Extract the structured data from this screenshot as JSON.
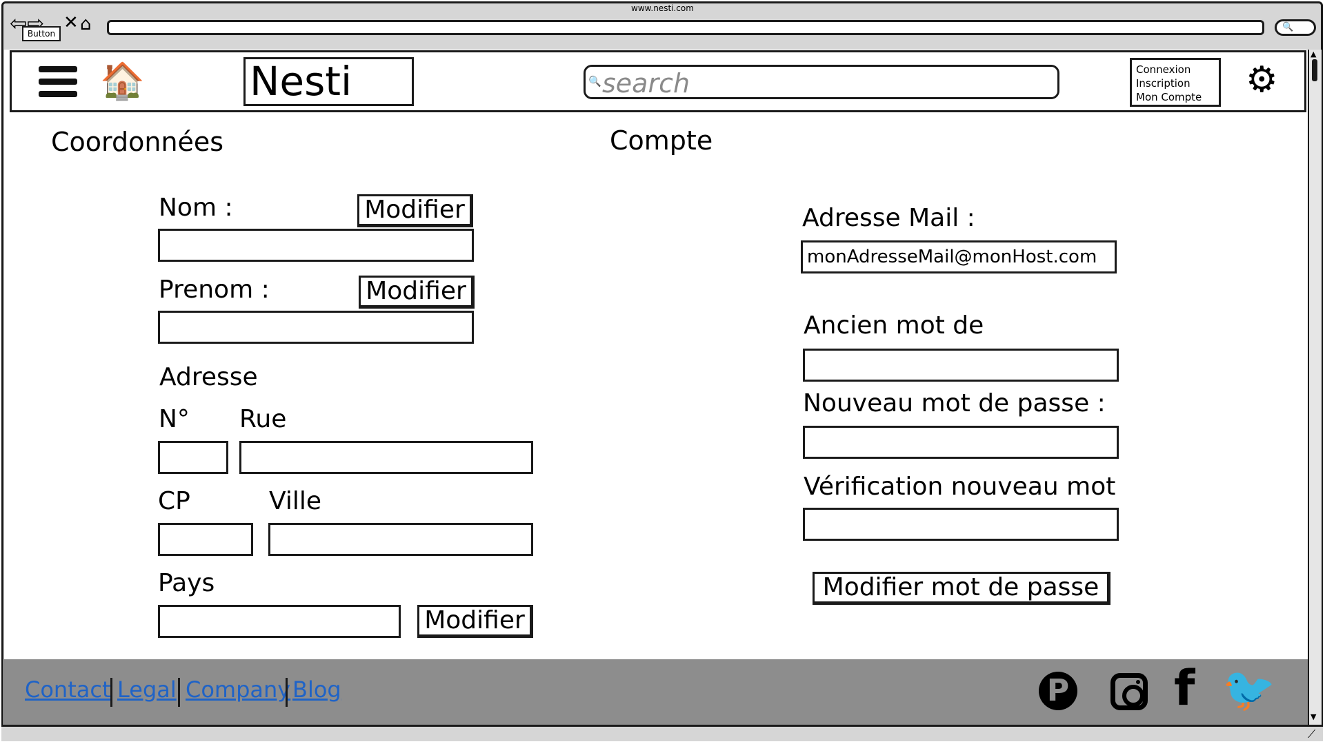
{
  "browser": {
    "url": "www.nesti.com",
    "button_label": "Button",
    "back_glyph": "⇦⇨",
    "close_glyph": "✕",
    "home_glyph": "⌂",
    "search_glyph": "🔍"
  },
  "header": {
    "menu_icon": "hamburger-icon",
    "home_icon": "home-icon",
    "home_glyph": "🏠",
    "logo": "Nesti",
    "search_placeholder": "search",
    "search_glyph": "🔍",
    "account_links": [
      "Connexion",
      "Inscription",
      "Mon Compte"
    ],
    "gear_glyph": "⚙"
  },
  "coordonnees": {
    "title": "Coordonnées",
    "nom_label": "Nom :",
    "prenom_label": "Prenom :",
    "modify_label": "Modifier",
    "adresse_title": "Adresse",
    "numero_label": "N°",
    "rue_label": "Rue",
    "cp_label": "CP",
    "ville_label": "Ville",
    "pays_label": "Pays"
  },
  "compte": {
    "title": "Compte",
    "email_label": "Adresse Mail :",
    "email_value": "monAdresseMail@monHost.com",
    "old_password_label": "Ancien mot de",
    "new_password_label": "Nouveau mot de passe :",
    "verify_password_label": "Vérification nouveau mot",
    "change_password_button": "Modifier mot de passe"
  },
  "footer": {
    "links": [
      "Contact",
      "Legal",
      "Company",
      "Blog"
    ],
    "social": {
      "pinterest": "P",
      "facebook": "f",
      "twitter": "🐦"
    },
    "colors": {
      "background": "#8d8d8d",
      "link": "#1f63c7"
    }
  }
}
